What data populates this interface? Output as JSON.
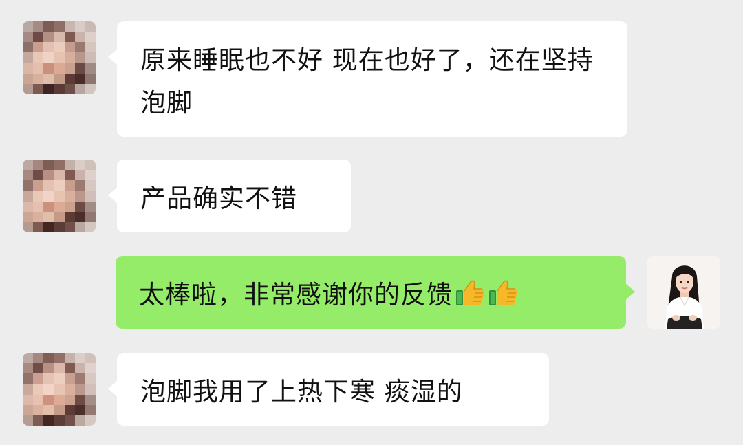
{
  "messages": [
    {
      "side": "left",
      "text": "原来睡眠也不好 现在也好了，还在坚持泡脚",
      "avatar": "blurred-avatar"
    },
    {
      "side": "left",
      "text": "产品确实不错",
      "avatar": "blurred-avatar"
    },
    {
      "side": "right",
      "text": "太棒啦，非常感谢你的反馈",
      "emoji": [
        "thumbs-up",
        "thumbs-up"
      ],
      "avatar": "user-avatar"
    },
    {
      "side": "left",
      "text": "泡脚我用了上热下寒 痰湿的",
      "avatar": "blurred-avatar"
    }
  ],
  "colors": {
    "background": "#ededed",
    "incoming_bubble": "#ffffff",
    "outgoing_bubble": "#95ec69",
    "text": "#111111"
  }
}
